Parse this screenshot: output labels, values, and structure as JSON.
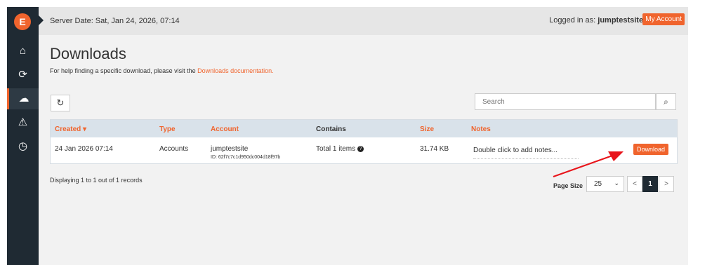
{
  "sidebar": {
    "logo": "E",
    "items": [
      {
        "icon": "home-icon",
        "glyph": "⌂"
      },
      {
        "icon": "sync-icon",
        "glyph": "⟳"
      },
      {
        "icon": "cloud-download-icon",
        "glyph": "☁"
      },
      {
        "icon": "warning-icon",
        "glyph": "⚠"
      },
      {
        "icon": "clock-icon",
        "glyph": "◷"
      }
    ]
  },
  "topbar": {
    "server_date": "Server Date: Sat, Jan 24, 2026, 07:14",
    "logged_prefix": "Logged in as: ",
    "username": "jumptestsite",
    "separator": " |",
    "my_account": "My Account"
  },
  "page": {
    "title": "Downloads",
    "help_prefix": "For help finding a specific download, please visit the ",
    "help_link": "Downloads documentation."
  },
  "toolbar": {
    "refresh_glyph": "↻",
    "search_placeholder": "Search",
    "search_glyph": "⌕"
  },
  "table": {
    "headers": {
      "created": "Created ▾",
      "type": "Type",
      "account": "Account",
      "contains": "Contains",
      "size": "Size",
      "notes": "Notes"
    },
    "rows": [
      {
        "created": "24 Jan 2026 07:14",
        "type": "Accounts",
        "account": "jumptestsite",
        "account_id": "ID: 62f7c7c1d950dc004d18f97b",
        "contains": "Total 1 items",
        "size": "31.74 KB",
        "notes": "Double click to add notes...",
        "download": "Download"
      }
    ]
  },
  "footer": {
    "records": "Displaying 1 to 1 out of 1 records",
    "page_size_label": "Page Size",
    "page_size_value": "25",
    "prev": "<",
    "current_page": "1",
    "next": ">"
  },
  "colors": {
    "accent": "#f0642d",
    "sidebar": "#1f2a33",
    "annotation_arrow": "#e8141a"
  }
}
